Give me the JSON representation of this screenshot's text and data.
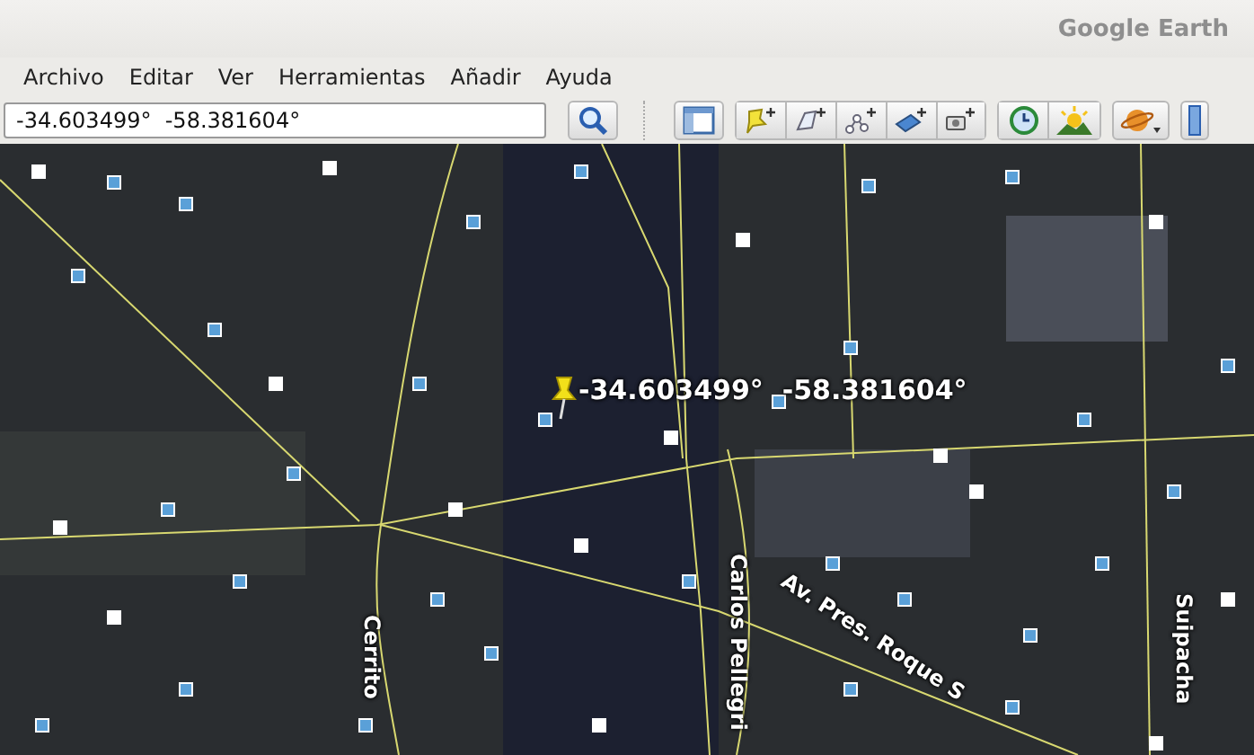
{
  "window": {
    "title": "Google Earth"
  },
  "menu": [
    {
      "label": "Archivo"
    },
    {
      "label": "Editar"
    },
    {
      "label": "Ver"
    },
    {
      "label": "Herramientas"
    },
    {
      "label": "Añadir"
    },
    {
      "label": "Ayuda"
    }
  ],
  "search": {
    "value": "-34.603499°  -58.381604°"
  },
  "map": {
    "placemark": {
      "label": "-34.603499°  -58.381604°"
    },
    "streets": [
      {
        "name": "Cerrito"
      },
      {
        "name": "Carlos Pellegri"
      },
      {
        "name": "Av. Pres. Roque S"
      },
      {
        "name": "Suipacha"
      }
    ]
  }
}
